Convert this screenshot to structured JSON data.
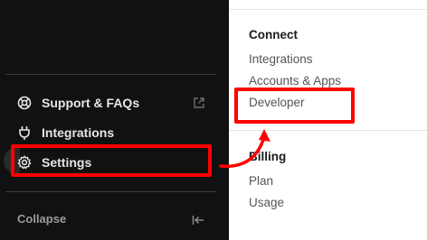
{
  "sidebar": {
    "items": [
      {
        "label": "Support & FAQs",
        "icon": "support-icon"
      },
      {
        "label": "Integrations",
        "icon": "plug-icon"
      },
      {
        "label": "Settings",
        "icon": "gear-icon"
      }
    ],
    "collapse_label": "Collapse"
  },
  "panel": {
    "connect": {
      "title": "Connect",
      "links": [
        "Integrations",
        "Accounts & Apps",
        "Developer"
      ]
    },
    "billing": {
      "title": "Billing",
      "links": [
        "Plan",
        "Usage"
      ]
    }
  },
  "colors": {
    "sidebar_bg": "#111111",
    "highlight": "#ff0000",
    "panel_bg": "#ffffff"
  }
}
